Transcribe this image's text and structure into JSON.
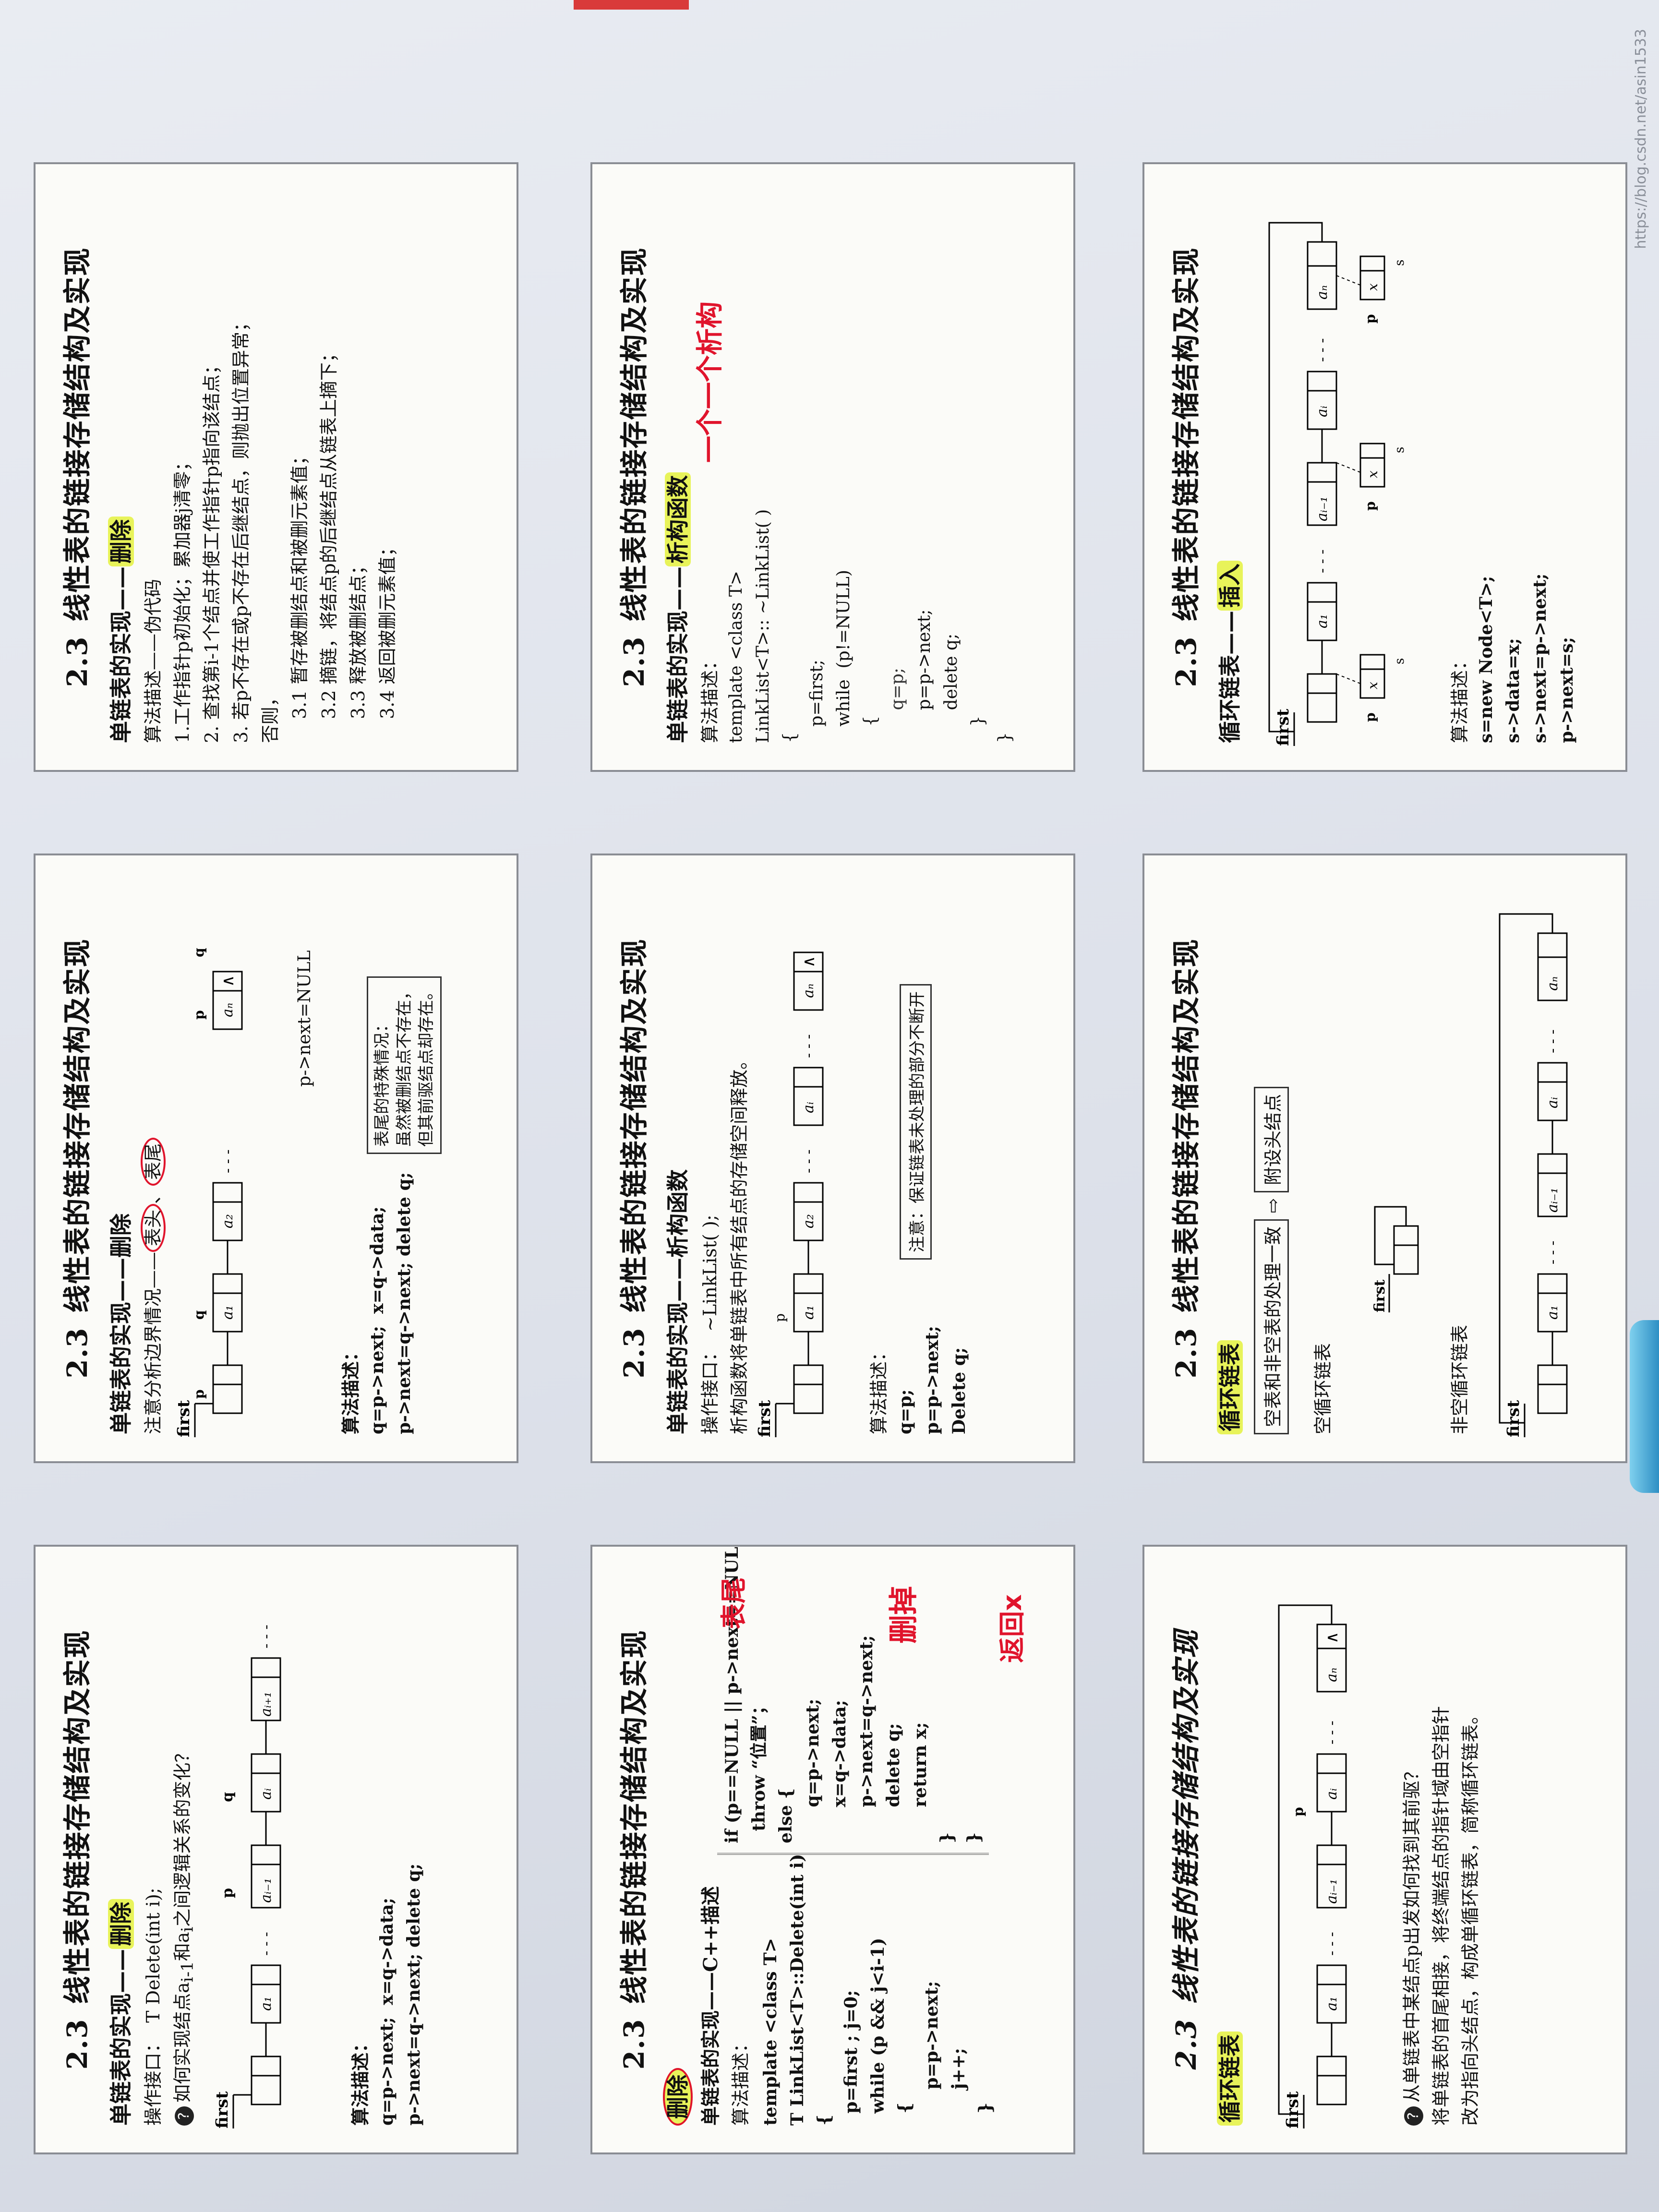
{
  "section": "2.3",
  "title": "线性表的链接存储结构及实现",
  "watermark": "https://blog.csdn.net/asin1533",
  "cards": {
    "c00": {
      "subtitle": "单链表的实现——",
      "subtitle_hl": "删除",
      "line1": "操作接口：  T Delete(int i);",
      "question": "如何实现结点a",
      "question2": "和a",
      "question3": "之间逻辑关系的变化？",
      "algo_label": "算法描述：",
      "code1": "q=p->next;  x=q->data;",
      "code2": "p->next=q->next; delete q;"
    },
    "c01": {
      "subtitle": "单链表的实现——",
      "subtitle_hl": "删除",
      "line1": "注意分析边界情况——",
      "head": "表头",
      "tail": "表尾",
      "algo_label": "算法描述：",
      "code1": "q=p->next;  x=q->data;",
      "code2": "p->next=q->next; delete q;",
      "pnext_null": "p->next=NULL",
      "note1": "表尾的特殊情况：",
      "note2": "虽然被删结点不存在，",
      "note3": "但其前驱结点却存在。"
    },
    "c02": {
      "subtitle": "单链表的实现——",
      "subtitle_hl": "删除",
      "line1": "算法描述——伪代码",
      "step1": "1.工作指针p初始化；累加器j清零；",
      "step2": "2. 查找第i-1个结点并使工作指针p指向该结点；",
      "step3": "3. 若p不存在或p不存在后继结点，则抛出位置异常；",
      "step3b": "否则，",
      "step31": "3.1 暂存被删结点和被删元素值；",
      "step32": "3.2 摘链，将结点p的后继结点从链表上摘下；",
      "step33": "3.3 释放被删结点；",
      "step34": "3.4 返回被删元素值；"
    },
    "c10": {
      "subtitle": "单链表的实现——C++描述",
      "subtitle_hl": "删除",
      "algo_label": "算法描述：",
      "code": [
        "template <class T>",
        "T LinkList<T>::Delete(int i)",
        "{",
        "  p=first ; j=0;",
        "  while (p && j<i-1)",
        "  {",
        "      p=p->next;",
        "      j++;",
        "  }"
      ],
      "code_right": [
        "if (p==NULL || p->next==NULL)",
        "  throw “位置”；",
        "else {",
        "      q=p->next;",
        "      x=q->data;",
        "      p->next=q->next;",
        "      delete q;",
        "      return x;",
        "}",
        "}"
      ],
      "annot1": "表尾",
      "annot2": "删掉",
      "annot3": "返回x"
    },
    "c11": {
      "subtitle": "单链表的实现——析构函数",
      "line1": "操作接口：  ~LinkList( );",
      "line2": "析构函数将单链表中所有结点的存储空间释放。",
      "algo_label": "算法描述：",
      "code": [
        "q=p;",
        "p=p->next;",
        "Delete q;"
      ],
      "note": "注意：保证链表未处理的部分不断开"
    },
    "c12": {
      "subtitle": "单链表的实现——",
      "subtitle_hl": "析构函数",
      "annot": "一个一个析构",
      "algo_label": "算法描述：",
      "code": [
        "template <class T>",
        "LinkList<T>:: ~LinkList( )",
        "{",
        "   p=first;",
        "   while  (p!=NULL)",
        "   {",
        "      q=p;",
        "      p=p->next;",
        "      delete q;",
        "   }",
        "}"
      ]
    },
    "c20": {
      "subtitle_hl": "循环链表",
      "question": "从单链表中某结点p出发如何找到其前驱？",
      "line1": "将单链表的首尾相接，将终端结点的指针域由空指针",
      "line2": "改为指向头结点，构成单循环链表，简称循环链表。"
    },
    "c21": {
      "subtitle_hl": "循环链表",
      "box1": "空表和非空表的处理一致",
      "box2": "附设头结点",
      "empty_label": "空循环链表",
      "nonempty_label": "非空循环链表"
    },
    "c22": {
      "subtitle": "循环链表——",
      "subtitle_hl": "插入",
      "algo_label": "算法描述：",
      "code": [
        "s=new Node<T>;",
        "s->data=x;",
        "s->next=p->next;",
        "p->next=s;"
      ]
    }
  },
  "diagram_labels": {
    "first": "first",
    "p": "p",
    "q": "q",
    "s": "s",
    "x": "x",
    "a1": "a₁",
    "a2": "a₂",
    "ai_1": "aᵢ₋₁",
    "ai": "aᵢ",
    "ai1": "aᵢ₊₁",
    "an": "aₙ",
    "dots": "- - -",
    "null": "∧"
  }
}
